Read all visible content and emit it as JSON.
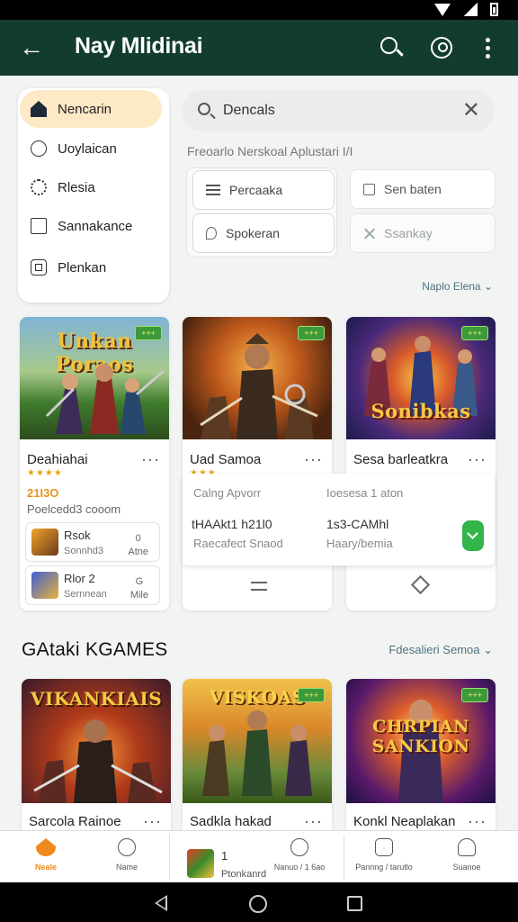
{
  "app": {
    "title": "Nay Mlidinai"
  },
  "sidebar": {
    "items": [
      {
        "label": "Nencarin",
        "icon": "home-icon",
        "active": true
      },
      {
        "label": "Uoylaican",
        "icon": "circle-icon"
      },
      {
        "label": "Rlesia",
        "icon": "face-icon"
      },
      {
        "label": "Sannakance",
        "icon": "square-icon"
      },
      {
        "label": "Plenkan",
        "icon": "box-icon"
      }
    ]
  },
  "search": {
    "value": "Dencals",
    "filter_label": "Freoarlo Nerskoal  Aplustari I/I",
    "chips": [
      "Percaaka",
      "Spokeran",
      "Sen baten",
      "Ssankay"
    ],
    "sort_label": "Naplo Elena ⌄"
  },
  "games_top": [
    {
      "art": "Unkan Poraos",
      "badge": "+++",
      "title": "Deahiahai",
      "stars": "★★★★",
      "price": "21I3O",
      "meta": "Poelcedd3 cooom"
    },
    {
      "art": "",
      "badge": "+++",
      "title": "Uad Samoa",
      "stars": "★★★"
    },
    {
      "art": "Sonibkas",
      "badge": "+++",
      "title": "Sesa barleatkra"
    }
  ],
  "mini_list": [
    {
      "title": "Rsok",
      "subtitle": "Sonnhd3",
      "right1": "0",
      "right2": "Atne"
    },
    {
      "title": "Rlor 2",
      "subtitle": "Sernnean",
      "right1": "G",
      "right2": "Mile"
    }
  ],
  "details": {
    "label_left": "Calng Apvorr",
    "label_right": "Ioesesa 1 aton",
    "value_left": "tHAAkt1 h21l0",
    "value_right": "1s3-CAMhl",
    "sub_left": "Raecafect Snaod",
    "sub_right": "Haary/bemia"
  },
  "section": {
    "title": "GAtaki KGAMES",
    "link": "Fdesalieri Semoa ⌄"
  },
  "games_bottom": [
    {
      "art": "VIKANKIAIS",
      "title": "Sarcola Rainoe"
    },
    {
      "art": "VISKOAS",
      "badge": "+++",
      "title": "Sadkla hakad"
    },
    {
      "art": "CHRPIAN SANKION",
      "badge": "+++",
      "title": "Konkl Neaplakan"
    }
  ],
  "nav": {
    "items": [
      {
        "label": "Neale",
        "icon": "home-icon",
        "active": true
      },
      {
        "label": "Name",
        "icon": "palette-icon"
      },
      {
        "label": "Ptonkanrd",
        "count": "1",
        "icon": "game-icon"
      },
      {
        "label": "Nanuo / 1 6ao",
        "icon": "clock-icon"
      },
      {
        "label": "Pannng / tarutlo",
        "icon": "timer-icon"
      },
      {
        "label": "Suanoe",
        "icon": "person-icon"
      }
    ]
  },
  "colors": {
    "appbar": "#123c2f",
    "accent": "#f08a1c",
    "active_sidebar": "#fde9c5",
    "check": "#34b54a"
  }
}
